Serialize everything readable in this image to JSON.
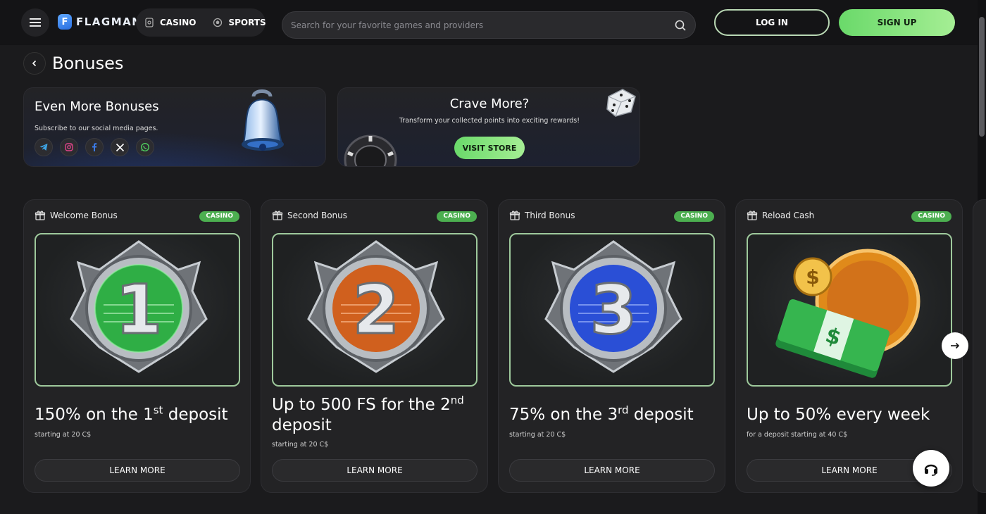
{
  "header": {
    "logo_text": "FLAGMAN",
    "logo_letter": "F",
    "nav": [
      {
        "label": "CASINO",
        "icon": "casino-icon"
      },
      {
        "label": "SPORTS",
        "icon": "sports-ball-icon"
      }
    ],
    "search_placeholder": "Search for your favorite games and providers",
    "login_label": "LOG IN",
    "signup_label": "SIGN UP"
  },
  "page": {
    "title": "Bonuses"
  },
  "promos": {
    "social": {
      "title": "Even More Bonuses",
      "subtitle": "Subscribe to our social media pages.",
      "networks": [
        "telegram-icon",
        "instagram-icon",
        "facebook-icon",
        "x-icon",
        "whatsapp-icon"
      ]
    },
    "store": {
      "title": "Crave More?",
      "subtitle": "Transform your collected points into exciting rewards!",
      "button_label": "VISIT STORE"
    }
  },
  "bonuses": [
    {
      "name": "Welcome Bonus",
      "tag": "CASINO",
      "title_pre": "150% on the 1",
      "title_sup": "st",
      "title_post": " deposit",
      "sub": "starting at 20 C$",
      "button": "LEARN MORE",
      "badge_number": "1",
      "badge_color": "#2fae45"
    },
    {
      "name": "Second Bonus",
      "tag": "CASINO",
      "title_pre": "Up to 500 FS for the 2",
      "title_sup": "nd",
      "title_post": " deposit",
      "sub": "starting at 20 C$",
      "button": "LEARN MORE",
      "badge_number": "2",
      "badge_color": "#d0601e"
    },
    {
      "name": "Third Bonus",
      "tag": "CASINO",
      "title_pre": "75% on the 3",
      "title_sup": "rd",
      "title_post": " deposit",
      "sub": "starting at 20 C$",
      "button": "LEARN MORE",
      "badge_number": "3",
      "badge_color": "#2a4fd6"
    },
    {
      "name": "Reload Cash",
      "tag": "CASINO",
      "title_pre": "Up to 50% every week",
      "title_sup": "",
      "title_post": "",
      "sub": "for a deposit starting at 40 C$",
      "button": "LEARN MORE",
      "badge_number": "$",
      "badge_color": "#e08a1a"
    }
  ],
  "colors": {
    "accent_green": "#6ad96a",
    "tag_green": "#4caf50",
    "background": "#1b1b1d"
  }
}
